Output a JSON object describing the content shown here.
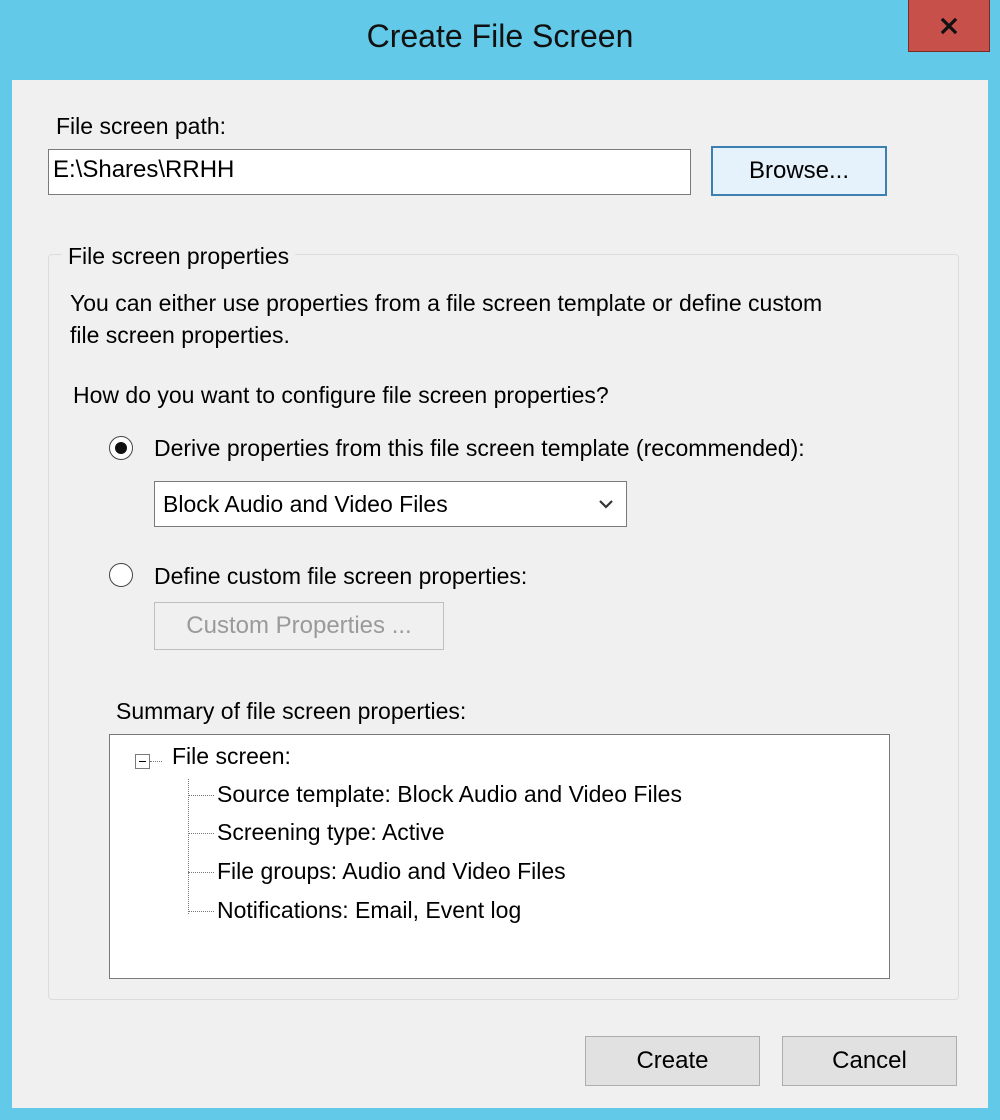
{
  "window": {
    "title": "Create File Screen",
    "close_label": "X"
  },
  "path": {
    "label": "File screen path:",
    "value": "E:\\Shares\\RRHH",
    "browse_label": "Browse..."
  },
  "properties": {
    "group_title": "File screen properties",
    "description_line1": "You can either use properties from a file screen template or define custom",
    "description_line2": "file screen properties.",
    "question": "How do you want to configure file screen properties?",
    "option_template": {
      "label": "Derive properties from this file screen template (recommended):",
      "selected": true
    },
    "template_combo": {
      "value": "Block Audio and Video Files"
    },
    "option_custom": {
      "label": "Define custom file screen properties:",
      "selected": false
    },
    "custom_button": "Custom Properties ...",
    "summary": {
      "label": "Summary of file screen properties:",
      "root": "File screen:",
      "items": [
        "Source template: Block Audio and Video Files",
        "Screening type: Active",
        "File groups: Audio and Video Files",
        "Notifications: Email, Event log"
      ]
    }
  },
  "footer": {
    "create_label": "Create",
    "cancel_label": "Cancel"
  }
}
